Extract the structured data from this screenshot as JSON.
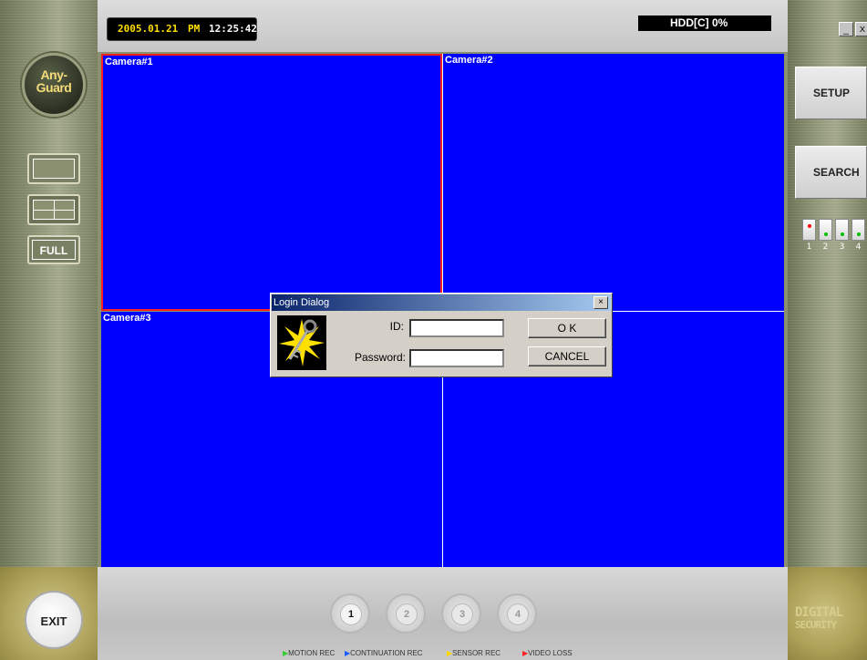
{
  "clock": {
    "date": "2005.01.21",
    "ampm": "PM",
    "time": "12:25:42"
  },
  "hdd": {
    "label": "HDD[C] 0%"
  },
  "window_buttons": {
    "minimize": "_",
    "close": "x"
  },
  "logo": {
    "line1": "Any-",
    "line2": "Guard"
  },
  "view": {
    "full_label": "FULL"
  },
  "right_panel": {
    "setup_label": "SETUP",
    "search_label": "SEARCH",
    "indicators": [
      {
        "num": "1",
        "color": "#ff0000"
      },
      {
        "num": "2",
        "color": "#00c000"
      },
      {
        "num": "3",
        "color": "#00c000"
      },
      {
        "num": "4",
        "color": "#00c000"
      }
    ]
  },
  "cameras": [
    {
      "label": "Camera#1",
      "selected": true
    },
    {
      "label": "Camera#2",
      "selected": false
    },
    {
      "label": "Camera#3",
      "selected": false
    },
    {
      "label": "",
      "selected": false
    }
  ],
  "login_dialog": {
    "title": "Login Dialog",
    "close_glyph": "×",
    "id_label": "ID:",
    "id_value": "",
    "password_label": "Password:",
    "password_value": "",
    "ok_label": "O K",
    "cancel_label": "CANCEL"
  },
  "bottom": {
    "exit_label": "EXIT",
    "channels": [
      "1",
      "2",
      "3",
      "4"
    ],
    "active_channel": "1",
    "legend": [
      {
        "label": "MOTION REC",
        "color": "#33cc33"
      },
      {
        "label": "CONTINUATION REC",
        "color": "#1e5bff"
      },
      {
        "label": "SENSOR REC",
        "color": "#ffd800"
      },
      {
        "label": "VIDEO LOSS",
        "color": "#ff2020"
      }
    ],
    "brand_line1": "DIGITAL",
    "brand_line2": "SECURITY"
  }
}
